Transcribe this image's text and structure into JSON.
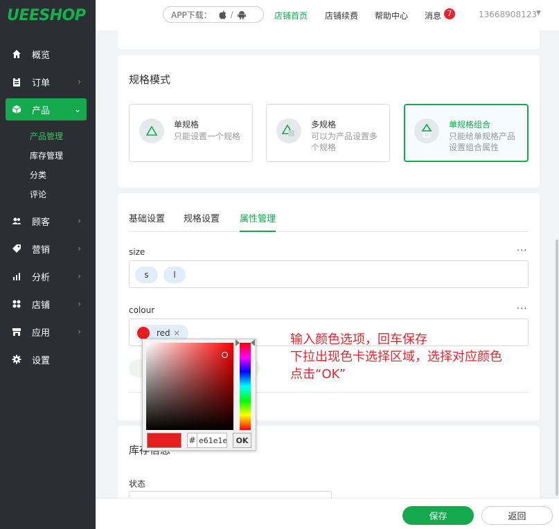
{
  "brand": "UEESHOP",
  "sidebar": {
    "items": [
      {
        "label": "概览",
        "icon": "home-icon"
      },
      {
        "label": "订单",
        "icon": "clipboard-icon"
      },
      {
        "label": "产品",
        "icon": "box-icon"
      },
      {
        "label": "顾客",
        "icon": "users-icon"
      },
      {
        "label": "营销",
        "icon": "tag-icon"
      },
      {
        "label": "分析",
        "icon": "bar-chart-icon"
      },
      {
        "label": "店铺",
        "icon": "grid-icon"
      },
      {
        "label": "应用",
        "icon": "store-icon"
      },
      {
        "label": "设置",
        "icon": "gear-icon"
      }
    ],
    "sub_items": [
      "产品管理",
      "库存管理",
      "分类",
      "评论"
    ]
  },
  "topbar": {
    "app_download": "APP下载：",
    "sep": "/",
    "links": [
      "店铺首页",
      "店铺续费",
      "帮助中心",
      "消息"
    ],
    "badge": "7",
    "phone": "13668908123"
  },
  "spec": {
    "title": "规格模式",
    "options": [
      {
        "title": "单规格",
        "desc": "只能设置一个规格"
      },
      {
        "title": "多规格",
        "desc": "可以为产品设置多个规格"
      },
      {
        "title": "单规格组合",
        "desc": "只能给单规格产品设置组合属性"
      }
    ]
  },
  "tabs": [
    "基础设置",
    "规格设置",
    "属性管理"
  ],
  "attributes": {
    "size_label": "size",
    "size_chips": [
      "s",
      "l"
    ],
    "colour_label": "colour",
    "colour_chip": "red",
    "more": "···"
  },
  "picker": {
    "hash": "#",
    "hex": "e61e1e",
    "ok": "OK",
    "color": "#e61e1e"
  },
  "annotation": {
    "line1": "输入颜色选项，回车保存",
    "line2": "下拉出现色卡选择区域，选择对应颜色",
    "line3": "点击“OK”"
  },
  "stock": {
    "title": "库存信息",
    "status_label": "状态"
  },
  "footer": {
    "save": "保存",
    "back": "返回"
  },
  "colors": {
    "accent": "#13a94c",
    "sidebar_bg": "#2b2e33",
    "annotation": "#e8232f"
  }
}
